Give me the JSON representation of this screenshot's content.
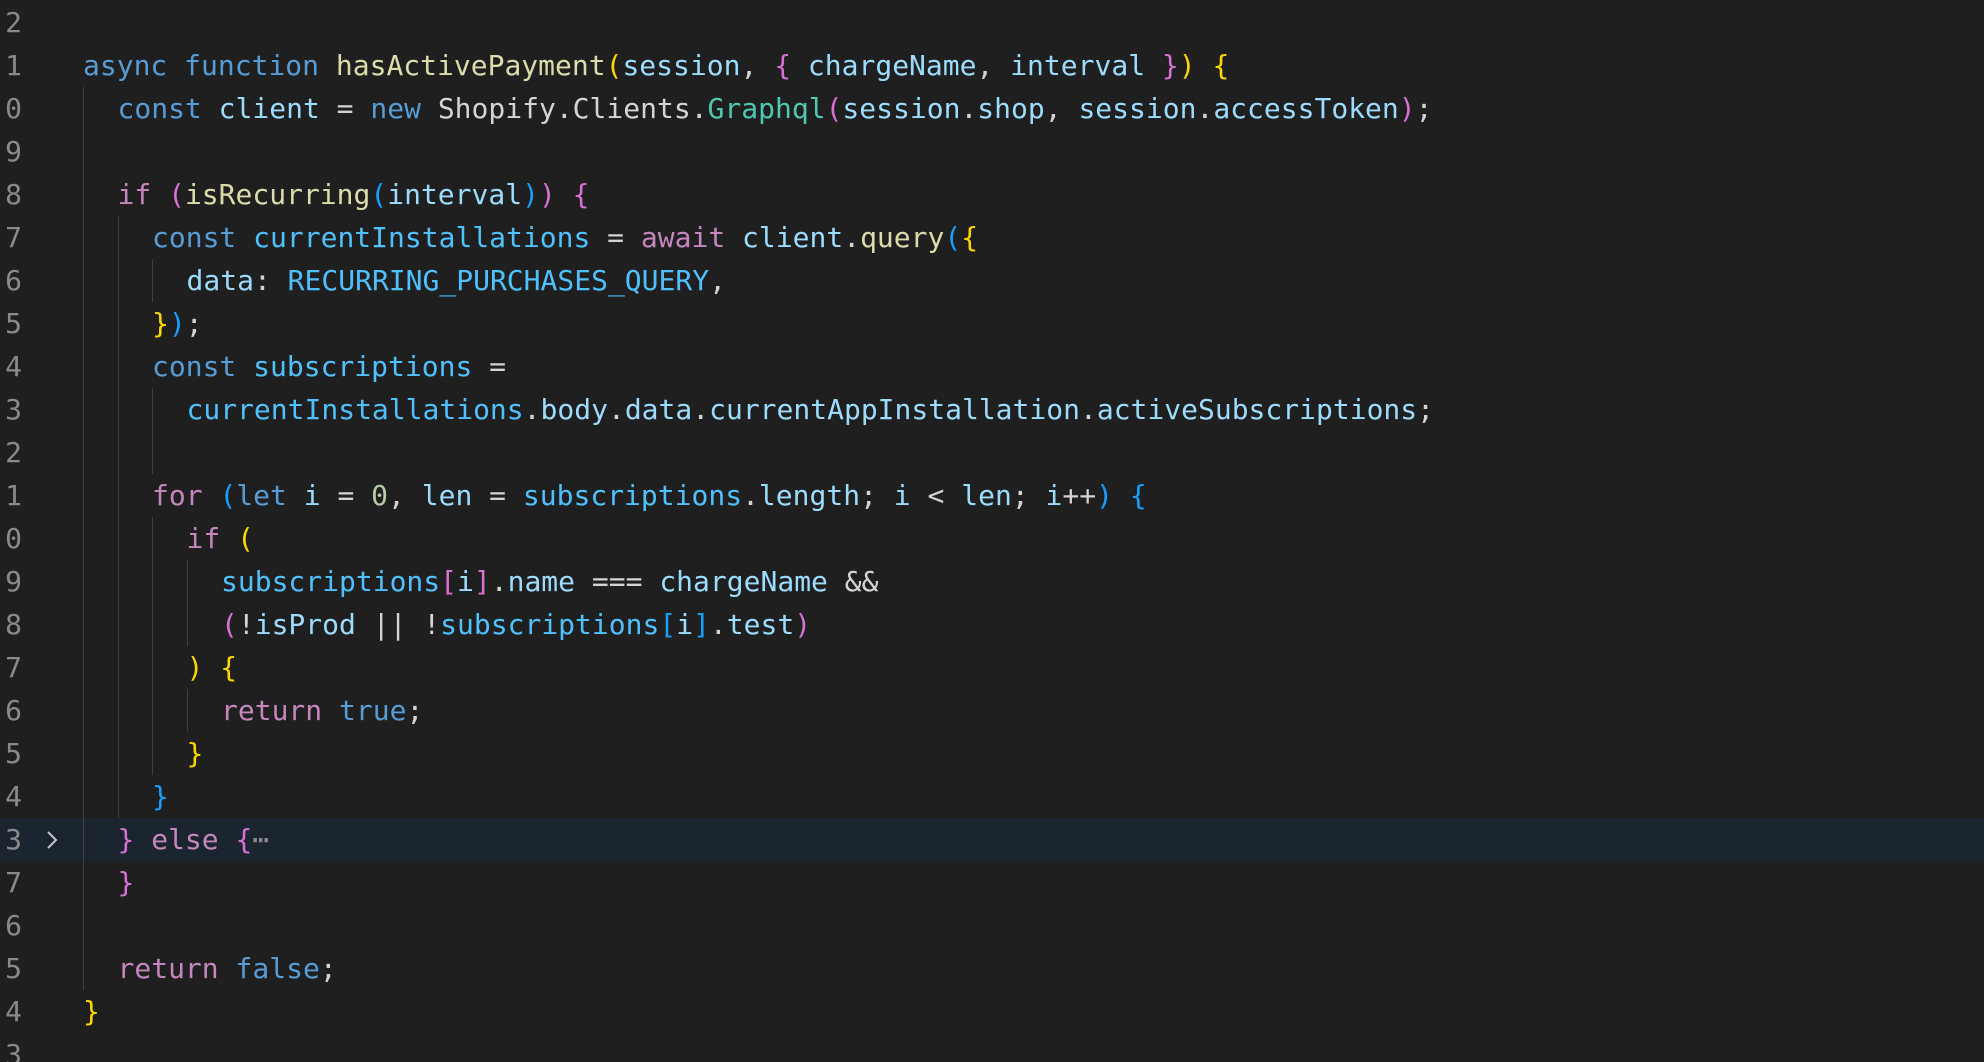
{
  "colors": {
    "background": "#1f1f1f",
    "highlight": "#1b2530",
    "line_number": "#8a8a8a",
    "indent_guide": "#404040",
    "keyword_storage": "#569cd6",
    "keyword_control": "#c586c0",
    "function": "#dcdcaa",
    "variable": "#9cdcfe",
    "constant": "#4fc1ff",
    "class": "#4ec9b0",
    "number": "#b5cea8",
    "text": "#d4d4d4",
    "bracket_1": "#ffd700",
    "bracket_2": "#da70d6",
    "bracket_3": "#179fff"
  },
  "editor": {
    "folded_line_icon": "chevron-right-icon",
    "lines": [
      {
        "num": "2",
        "indent": 0,
        "tokens": []
      },
      {
        "num": "1",
        "indent": 0,
        "tokens": [
          {
            "t": "async",
            "c": "keyword_storage"
          },
          {
            "t": " ",
            "c": "text"
          },
          {
            "t": "function",
            "c": "keyword_storage"
          },
          {
            "t": " ",
            "c": "text"
          },
          {
            "t": "hasActivePayment",
            "c": "function"
          },
          {
            "t": "(",
            "c": "bracket_1"
          },
          {
            "t": "session",
            "c": "variable"
          },
          {
            "t": ", ",
            "c": "text"
          },
          {
            "t": "{",
            "c": "bracket_2"
          },
          {
            "t": " ",
            "c": "text"
          },
          {
            "t": "chargeName",
            "c": "variable"
          },
          {
            "t": ", ",
            "c": "text"
          },
          {
            "t": "interval",
            "c": "variable"
          },
          {
            "t": " ",
            "c": "text"
          },
          {
            "t": "}",
            "c": "bracket_2"
          },
          {
            "t": ")",
            "c": "bracket_1"
          },
          {
            "t": " ",
            "c": "text"
          },
          {
            "t": "{",
            "c": "bracket_1"
          }
        ]
      },
      {
        "num": "0",
        "indent": 1,
        "tokens": [
          {
            "t": "const",
            "c": "keyword_storage"
          },
          {
            "t": " ",
            "c": "text"
          },
          {
            "t": "client",
            "c": "variable"
          },
          {
            "t": " = ",
            "c": "text"
          },
          {
            "t": "new",
            "c": "keyword_storage"
          },
          {
            "t": " Shopify.Clients.",
            "c": "text"
          },
          {
            "t": "Graphql",
            "c": "class"
          },
          {
            "t": "(",
            "c": "bracket_2"
          },
          {
            "t": "session",
            "c": "variable"
          },
          {
            "t": ".",
            "c": "text"
          },
          {
            "t": "shop",
            "c": "variable"
          },
          {
            "t": ", ",
            "c": "text"
          },
          {
            "t": "session",
            "c": "variable"
          },
          {
            "t": ".",
            "c": "text"
          },
          {
            "t": "accessToken",
            "c": "variable"
          },
          {
            "t": ")",
            "c": "bracket_2"
          },
          {
            "t": ";",
            "c": "text"
          }
        ]
      },
      {
        "num": "9",
        "indent": 1,
        "tokens": []
      },
      {
        "num": "8",
        "indent": 1,
        "tokens": [
          {
            "t": "if",
            "c": "keyword_control"
          },
          {
            "t": " ",
            "c": "text"
          },
          {
            "t": "(",
            "c": "bracket_2"
          },
          {
            "t": "isRecurring",
            "c": "function"
          },
          {
            "t": "(",
            "c": "bracket_3"
          },
          {
            "t": "interval",
            "c": "variable"
          },
          {
            "t": ")",
            "c": "bracket_3"
          },
          {
            "t": ")",
            "c": "bracket_2"
          },
          {
            "t": " ",
            "c": "text"
          },
          {
            "t": "{",
            "c": "bracket_2"
          }
        ]
      },
      {
        "num": "7",
        "indent": 2,
        "tokens": [
          {
            "t": "const",
            "c": "keyword_storage"
          },
          {
            "t": " ",
            "c": "text"
          },
          {
            "t": "currentInstallations",
            "c": "constant"
          },
          {
            "t": " = ",
            "c": "text"
          },
          {
            "t": "await",
            "c": "keyword_control"
          },
          {
            "t": " ",
            "c": "text"
          },
          {
            "t": "client",
            "c": "variable"
          },
          {
            "t": ".",
            "c": "text"
          },
          {
            "t": "query",
            "c": "function"
          },
          {
            "t": "(",
            "c": "bracket_3"
          },
          {
            "t": "{",
            "c": "bracket_1"
          }
        ]
      },
      {
        "num": "6",
        "indent": 3,
        "tokens": [
          {
            "t": "data",
            "c": "variable"
          },
          {
            "t": ": ",
            "c": "text"
          },
          {
            "t": "RECURRING_PURCHASES_QUERY",
            "c": "constant"
          },
          {
            "t": ",",
            "c": "text"
          }
        ]
      },
      {
        "num": "5",
        "indent": 2,
        "tokens": [
          {
            "t": "}",
            "c": "bracket_1"
          },
          {
            "t": ")",
            "c": "bracket_3"
          },
          {
            "t": ";",
            "c": "text"
          }
        ]
      },
      {
        "num": "4",
        "indent": 2,
        "tokens": [
          {
            "t": "const",
            "c": "keyword_storage"
          },
          {
            "t": " ",
            "c": "text"
          },
          {
            "t": "subscriptions",
            "c": "constant"
          },
          {
            "t": " =",
            "c": "text"
          }
        ]
      },
      {
        "num": "3",
        "indent": 3,
        "tokens": [
          {
            "t": "currentInstallations",
            "c": "constant"
          },
          {
            "t": ".",
            "c": "text"
          },
          {
            "t": "body",
            "c": "variable"
          },
          {
            "t": ".",
            "c": "text"
          },
          {
            "t": "data",
            "c": "variable"
          },
          {
            "t": ".",
            "c": "text"
          },
          {
            "t": "currentAppInstallation",
            "c": "variable"
          },
          {
            "t": ".",
            "c": "text"
          },
          {
            "t": "activeSubscriptions",
            "c": "variable"
          },
          {
            "t": ";",
            "c": "text"
          }
        ]
      },
      {
        "num": "2",
        "indent": 3,
        "tokens": []
      },
      {
        "num": "1",
        "indent": 2,
        "tokens": [
          {
            "t": "for",
            "c": "keyword_control"
          },
          {
            "t": " ",
            "c": "text"
          },
          {
            "t": "(",
            "c": "bracket_3"
          },
          {
            "t": "let",
            "c": "keyword_storage"
          },
          {
            "t": " ",
            "c": "text"
          },
          {
            "t": "i",
            "c": "variable"
          },
          {
            "t": " = ",
            "c": "text"
          },
          {
            "t": "0",
            "c": "number"
          },
          {
            "t": ", ",
            "c": "text"
          },
          {
            "t": "len",
            "c": "variable"
          },
          {
            "t": " = ",
            "c": "text"
          },
          {
            "t": "subscriptions",
            "c": "constant"
          },
          {
            "t": ".",
            "c": "text"
          },
          {
            "t": "length",
            "c": "variable"
          },
          {
            "t": "; ",
            "c": "text"
          },
          {
            "t": "i",
            "c": "variable"
          },
          {
            "t": " < ",
            "c": "text"
          },
          {
            "t": "len",
            "c": "variable"
          },
          {
            "t": "; ",
            "c": "text"
          },
          {
            "t": "i",
            "c": "variable"
          },
          {
            "t": "++",
            "c": "text"
          },
          {
            "t": ")",
            "c": "bracket_3"
          },
          {
            "t": " ",
            "c": "text"
          },
          {
            "t": "{",
            "c": "bracket_3"
          }
        ]
      },
      {
        "num": "0",
        "indent": 3,
        "tokens": [
          {
            "t": "if",
            "c": "keyword_control"
          },
          {
            "t": " ",
            "c": "text"
          },
          {
            "t": "(",
            "c": "bracket_1"
          }
        ]
      },
      {
        "num": "9",
        "indent": 4,
        "tokens": [
          {
            "t": "subscriptions",
            "c": "constant"
          },
          {
            "t": "[",
            "c": "bracket_2"
          },
          {
            "t": "i",
            "c": "variable"
          },
          {
            "t": "]",
            "c": "bracket_2"
          },
          {
            "t": ".",
            "c": "text"
          },
          {
            "t": "name",
            "c": "variable"
          },
          {
            "t": " === ",
            "c": "text"
          },
          {
            "t": "chargeName",
            "c": "variable"
          },
          {
            "t": " &&",
            "c": "text"
          }
        ]
      },
      {
        "num": "8",
        "indent": 4,
        "tokens": [
          {
            "t": "(",
            "c": "bracket_2"
          },
          {
            "t": "!",
            "c": "text"
          },
          {
            "t": "isProd",
            "c": "variable"
          },
          {
            "t": " || !",
            "c": "text"
          },
          {
            "t": "subscriptions",
            "c": "constant"
          },
          {
            "t": "[",
            "c": "bracket_3"
          },
          {
            "t": "i",
            "c": "variable"
          },
          {
            "t": "]",
            "c": "bracket_3"
          },
          {
            "t": ".",
            "c": "text"
          },
          {
            "t": "test",
            "c": "variable"
          },
          {
            "t": ")",
            "c": "bracket_2"
          }
        ]
      },
      {
        "num": "7",
        "indent": 3,
        "tokens": [
          {
            "t": ")",
            "c": "bracket_1"
          },
          {
            "t": " ",
            "c": "text"
          },
          {
            "t": "{",
            "c": "bracket_1"
          }
        ]
      },
      {
        "num": "6",
        "indent": 4,
        "tokens": [
          {
            "t": "return",
            "c": "keyword_control"
          },
          {
            "t": " ",
            "c": "text"
          },
          {
            "t": "true",
            "c": "keyword_storage"
          },
          {
            "t": ";",
            "c": "text"
          }
        ]
      },
      {
        "num": "5",
        "indent": 3,
        "tokens": [
          {
            "t": "}",
            "c": "bracket_1"
          }
        ]
      },
      {
        "num": "4",
        "indent": 2,
        "tokens": [
          {
            "t": "}",
            "c": "bracket_3"
          }
        ]
      },
      {
        "num": "3",
        "indent": 1,
        "folded": true,
        "highlighted": true,
        "tokens": [
          {
            "t": "}",
            "c": "bracket_2"
          },
          {
            "t": " ",
            "c": "text"
          },
          {
            "t": "else",
            "c": "keyword_control"
          },
          {
            "t": " ",
            "c": "text"
          },
          {
            "t": "{",
            "c": "bracket_2"
          },
          {
            "t": "⋯",
            "c": "line_number"
          }
        ]
      },
      {
        "num": "7",
        "indent": 1,
        "tokens": [
          {
            "t": "}",
            "c": "bracket_2"
          }
        ]
      },
      {
        "num": "6",
        "indent": 1,
        "tokens": []
      },
      {
        "num": "5",
        "indent": 1,
        "tokens": [
          {
            "t": "return",
            "c": "keyword_control"
          },
          {
            "t": " ",
            "c": "text"
          },
          {
            "t": "false",
            "c": "keyword_storage"
          },
          {
            "t": ";",
            "c": "text"
          }
        ]
      },
      {
        "num": "4",
        "indent": 0,
        "tokens": [
          {
            "t": "}",
            "c": "bracket_1"
          }
        ]
      },
      {
        "num": "3",
        "indent": 0,
        "tokens": []
      }
    ]
  }
}
